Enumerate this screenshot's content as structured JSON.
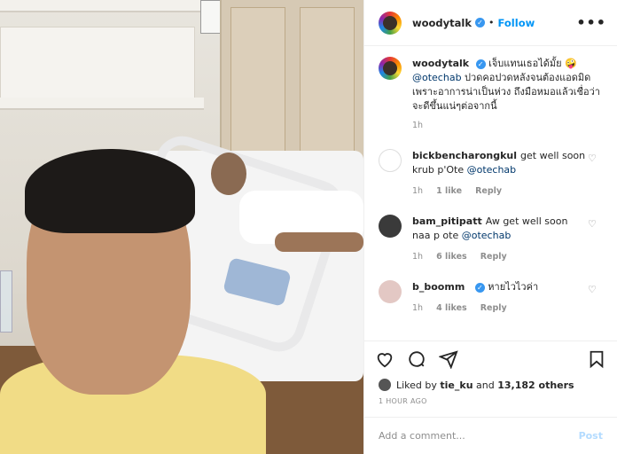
{
  "header": {
    "username": "woodytalk",
    "follow_label": "Follow",
    "more_icon": "•••"
  },
  "caption": {
    "username": "woodytalk",
    "text_1": "เจ็บแทนเธอได้มั้ย 🤪",
    "mention": "@otechab",
    "text_2": " ปวดคอปวดหลังจนต้องแอดมิดเพราะอาการน่าเป็นห่วง ถึงมือหมอแล้วเชื่อว่าจะดีขึ้นแน่ๆต่อจากนี้",
    "time": "1h"
  },
  "comments": [
    {
      "username": "bickbencharongkul",
      "text": "get well soon krub p'Ote ",
      "mention": "@otechab",
      "time": "1h",
      "likes": "1 like",
      "reply": "Reply",
      "avatar_color": "#ffffff"
    },
    {
      "username": "bam_pitipatt",
      "text": "Aw get well soon naa p ote ",
      "mention": "@otechab",
      "time": "1h",
      "likes": "6 likes",
      "reply": "Reply",
      "avatar_color": "#3a3a3a"
    },
    {
      "username": "b_boomm",
      "text": "หายไวไวค่า",
      "mention": "",
      "time": "1h",
      "likes": "4 likes",
      "reply": "Reply",
      "avatar_color": "#e3c8c4"
    }
  ],
  "likes": {
    "prefix": "Liked by ",
    "user": "tie_ku",
    "middle": " and ",
    "count": "13,182 others"
  },
  "time_ago": "1 HOUR AGO",
  "add_comment": {
    "placeholder": "Add a comment...",
    "post_label": "Post"
  }
}
